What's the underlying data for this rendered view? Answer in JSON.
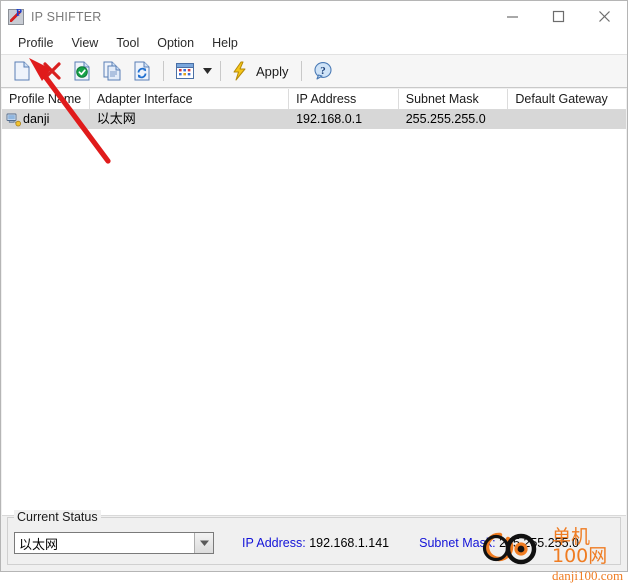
{
  "window": {
    "title": "IP SHIFTER",
    "app_icon": "app-icon",
    "controls": {
      "minimize": "minimize-icon",
      "maximize": "maximize-icon",
      "close": "close-icon"
    }
  },
  "menubar": {
    "items": [
      {
        "label": "Profile"
      },
      {
        "label": "View"
      },
      {
        "label": "Tool"
      },
      {
        "label": "Option"
      },
      {
        "label": "Help"
      }
    ]
  },
  "toolbar": {
    "buttons": [
      {
        "name": "new-profile-button",
        "icon": "new-document-icon"
      },
      {
        "name": "delete-profile-button",
        "icon": "red-x-icon"
      },
      {
        "name": "apply-profile-button",
        "icon": "document-check-icon"
      },
      {
        "name": "copy-profile-button",
        "icon": "document-copy-icon"
      },
      {
        "name": "refresh-profile-button",
        "icon": "document-refresh-icon"
      },
      {
        "name": "view-mode-button",
        "icon": "grid-view-icon"
      },
      {
        "name": "view-mode-dropdown",
        "icon": "chevron-down-icon"
      },
      {
        "name": "apply-button",
        "icon": "lightning-bolt-icon",
        "label": "Apply"
      },
      {
        "name": "help-button",
        "icon": "question-help-icon"
      }
    ],
    "apply_label": "Apply"
  },
  "list": {
    "columns": [
      {
        "label": "Profile Name"
      },
      {
        "label": "Adapter Interface"
      },
      {
        "label": "IP Address"
      },
      {
        "label": "Subnet Mask"
      },
      {
        "label": "Default Gateway"
      }
    ],
    "rows": [
      {
        "icon": "network-profile-icon",
        "profile_name": "danji",
        "adapter_interface": "以太网",
        "ip_address": "192.168.0.1",
        "subnet_mask": "255.255.255.0",
        "default_gateway": ""
      }
    ]
  },
  "status": {
    "legend": "Current Status",
    "adapter_selected": "以太网",
    "ip_label": "IP Address:",
    "ip_value": "192.168.1.141",
    "mask_label": "Subnet Mask:",
    "mask_value": "255.255.255.0"
  },
  "annotation": {
    "arrow": "red-pointer-arrow",
    "color": "#e01b1b"
  },
  "watermark": {
    "logo": "go-circle-logo",
    "cn_text": "单机100网",
    "en_text": "danji100.com",
    "color": "#ef7c22"
  }
}
